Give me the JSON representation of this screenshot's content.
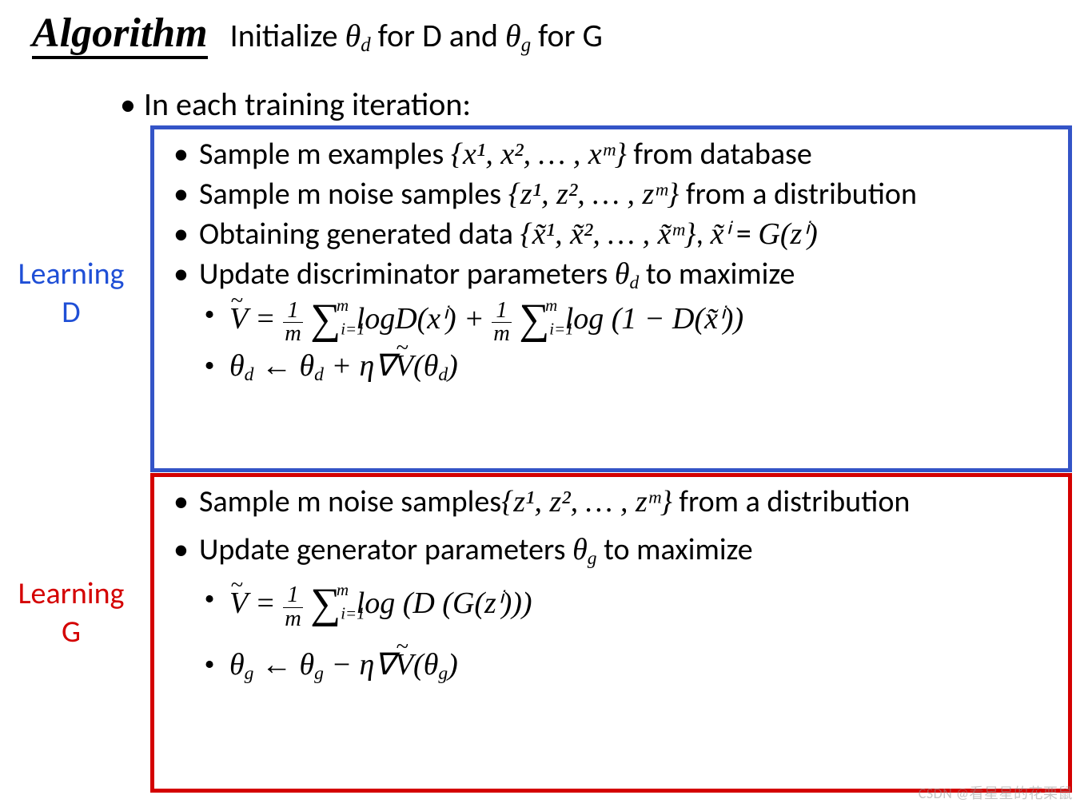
{
  "title": {
    "label": "Algorithm",
    "text_before": "Initialize ",
    "theta_d": "θ",
    "theta_d_sub": "d",
    "mid1": " for D and ",
    "theta_g": "θ",
    "theta_g_sub": "g",
    "mid2": " for G"
  },
  "iteration_line": "In each training iteration:",
  "side_labels": {
    "d_line1": "Learning",
    "d_line2": "D",
    "g_line1": "Learning",
    "g_line2": "G"
  },
  "box_d": {
    "b1_pre": "Sample m examples ",
    "b1_set": "{x¹, x², … , xᵐ}",
    "b1_post": " from database",
    "b2_pre": "Sample m noise samples ",
    "b2_set": "{z¹, z², … , zᵐ}",
    "b2_post": " from a distribution",
    "b3_pre": "Obtaining generated data ",
    "b3_set": "{x̃¹, x̃², … , x̃ᵐ}",
    "b3_mid": ", ",
    "b3_eq_lhs": "x̃ⁱ",
    "b3_eq_mid": " = ",
    "b3_eq_rhs": "G(zⁱ)",
    "b4_pre": "Update discriminator parameters ",
    "b4_sym": "θ",
    "b4_sub": "d",
    "b4_post": " to maximize",
    "eq1_lhs": "Ṽ",
    "eq1_eq": " = ",
    "eq1_frac_n": "1",
    "eq1_frac_d": "m",
    "eq1_sum": "∑",
    "eq1_sum_lo": "i=1",
    "eq1_sum_hi": "m",
    "eq1_mid1": " logD(xⁱ) + ",
    "eq1_mid2": " log (1 − D(x̃ⁱ))",
    "eq2": "θ_d ← θ_d + η∇Ṽ(θ_d)"
  },
  "box_g": {
    "b1_pre": "Sample m noise samples",
    "b1_set": "{z¹, z², … , zᵐ}",
    "b1_post": " from a distribution",
    "b2_pre": "Update generator parameters ",
    "b2_sym": "θ",
    "b2_sub": "g",
    "b2_post": " to maximize",
    "eq1_lhs": "Ṽ",
    "eq1_eq": " = ",
    "eq1_frac_n": "1",
    "eq1_frac_d": "m",
    "eq1_sum": "∑",
    "eq1_sum_lo": "i=1",
    "eq1_sum_hi": "m",
    "eq1_tail": " log (D (G(zⁱ)))",
    "eq2": "θ_g ← θ_g − η∇Ṽ(θ_g)"
  },
  "watermark": "CSDN @看星星的花栗鼠"
}
